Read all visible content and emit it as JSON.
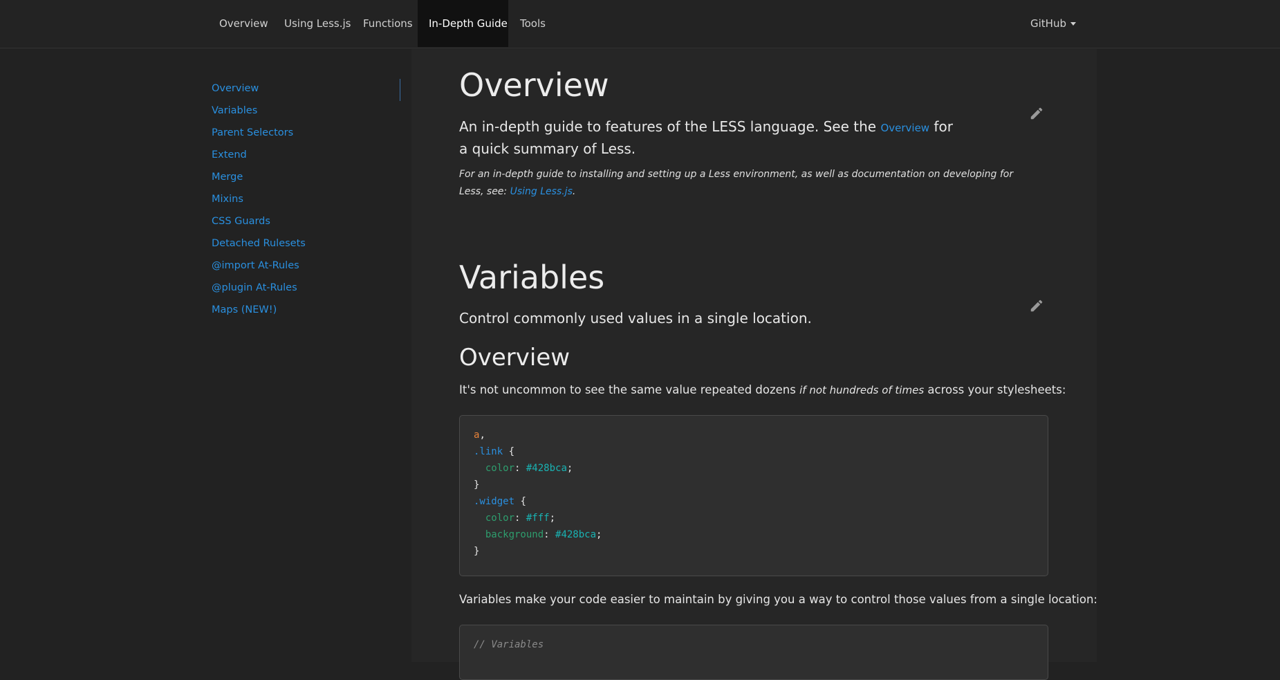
{
  "nav": {
    "items": [
      {
        "label": "Overview",
        "active": false
      },
      {
        "label": "Using Less.js",
        "active": false
      },
      {
        "label": "Functions",
        "active": false
      },
      {
        "label": "In-Depth Guide",
        "active": true
      },
      {
        "label": "Tools",
        "active": false
      }
    ],
    "github_label": "GitHub"
  },
  "sidebar": {
    "items": [
      {
        "label": "Overview"
      },
      {
        "label": "Variables"
      },
      {
        "label": "Parent Selectors"
      },
      {
        "label": "Extend"
      },
      {
        "label": "Merge"
      },
      {
        "label": "Mixins"
      },
      {
        "label": "CSS Guards"
      },
      {
        "label": "Detached Rulesets"
      },
      {
        "label": "@import At-Rules"
      },
      {
        "label": "@plugin At-Rules"
      },
      {
        "label": "Maps (NEW!)"
      }
    ]
  },
  "overview": {
    "title": "Overview",
    "lead_before": "An in-depth guide to features of the LESS language. See the ",
    "lead_link": "Overview",
    "lead_after": " for a quick summary of Less.",
    "note_before": "For an in-depth guide to installing and setting up a Less environment, as well as documentation on developing for Less, see: ",
    "note_link": "Using Less.js",
    "note_after": "."
  },
  "variables": {
    "title": "Variables",
    "lead": "Control commonly used values in a single location.",
    "sub_title": "Overview",
    "para1_before": "It's not uncommon to see the same value repeated dozens ",
    "para1_em": "if not hundreds of times",
    "para1_after": " across your stylesheets:",
    "para2": "Variables make your code easier to maintain by giving you a way to control those values from a single location:",
    "code1": {
      "lines": [
        [
          {
            "t": "a",
            "c": "tag"
          },
          {
            "t": ",",
            "c": "punc"
          }
        ],
        [
          {
            "t": ".link",
            "c": "cls"
          },
          {
            "t": " {",
            "c": "punc"
          }
        ],
        [
          {
            "t": "  color",
            "c": "prop"
          },
          {
            "t": ": ",
            "c": "punc"
          },
          {
            "t": "#428bca",
            "c": "val"
          },
          {
            "t": ";",
            "c": "punc"
          }
        ],
        [
          {
            "t": "}",
            "c": "punc"
          }
        ],
        [
          {
            "t": ".widget",
            "c": "cls"
          },
          {
            "t": " {",
            "c": "punc"
          }
        ],
        [
          {
            "t": "  color",
            "c": "prop"
          },
          {
            "t": ": ",
            "c": "punc"
          },
          {
            "t": "#fff",
            "c": "val"
          },
          {
            "t": ";",
            "c": "punc"
          }
        ],
        [
          {
            "t": "  background",
            "c": "prop"
          },
          {
            "t": ": ",
            "c": "punc"
          },
          {
            "t": "#428bca",
            "c": "val"
          },
          {
            "t": ";",
            "c": "punc"
          }
        ],
        [
          {
            "t": "}",
            "c": "punc"
          }
        ]
      ]
    },
    "code2": {
      "lines": [
        [
          {
            "t": "// Variables",
            "c": "comment"
          }
        ]
      ]
    }
  },
  "icons": {
    "edit": "pencil-icon",
    "caret": "chevron-down-icon"
  },
  "colors": {
    "background": "#222222",
    "link": "#2a90e0",
    "active_nav_bg": "#111111"
  }
}
